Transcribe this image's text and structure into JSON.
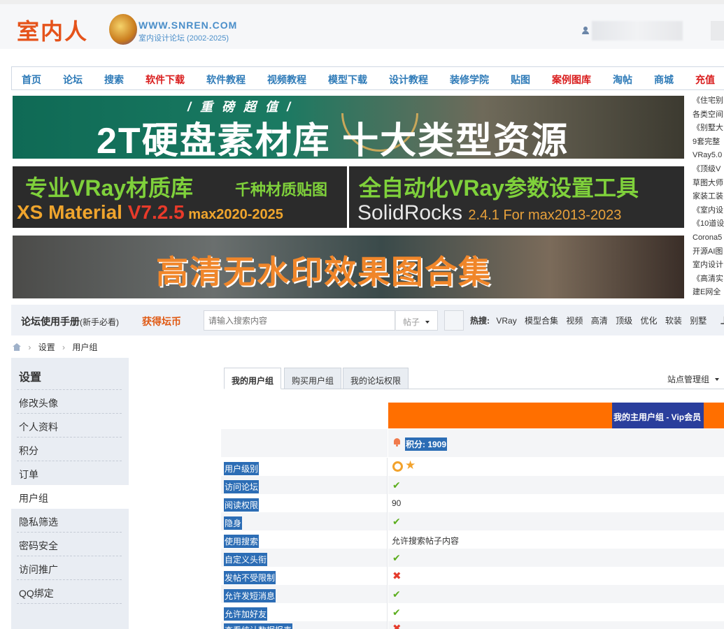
{
  "header": {
    "logo_text": "室内人",
    "site_url": "WWW.SNREN.COM",
    "site_sub": "室内设计论坛 (2002-2025)"
  },
  "nav": [
    {
      "label": "首页",
      "highlight": false
    },
    {
      "label": "论坛",
      "highlight": false
    },
    {
      "label": "搜索",
      "highlight": false
    },
    {
      "label": "软件下载",
      "highlight": true
    },
    {
      "label": "软件教程",
      "highlight": false
    },
    {
      "label": "视频教程",
      "highlight": false
    },
    {
      "label": "模型下载",
      "highlight": false
    },
    {
      "label": "设计教程",
      "highlight": false
    },
    {
      "label": "装修学院",
      "highlight": false
    },
    {
      "label": "贴图",
      "highlight": false
    },
    {
      "label": "案例图库",
      "highlight": true
    },
    {
      "label": "淘帖",
      "highlight": false
    },
    {
      "label": "商城",
      "highlight": false
    },
    {
      "label": "充值",
      "highlight": true
    }
  ],
  "banners": {
    "b1_sub": "/ 重 磅 超 值 /",
    "b1_main": "2T硬盘素材库  十大类型资源",
    "b2_l1": "专业VRay材质库",
    "b2_l1b": "千种材质贴图",
    "b2_l2a": "XS Material ",
    "b2_l2b": "V7.2.5",
    "b2_l2c": " max2020-2025",
    "b3_l1": "全自动化VRay参数设置工具",
    "b3_l2a": "SolidRocks ",
    "b3_l2b": "2.4.1 For max2013-2023",
    "b4_main": "高清无水印效果图合集"
  },
  "side_links": [
    "《住宅别",
    "各类空间",
    "《别墅大",
    "9套完整",
    "VRay5.0",
    "《顶级V",
    "草图大师",
    "家装工装",
    "《室内设",
    "《10道设",
    "Corona5",
    "开源AI图",
    "室内设计",
    "《高清实",
    "建E网全"
  ],
  "toolbar": {
    "manual": "论坛使用手册",
    "manual_note": "(新手必看)",
    "coins": "获得坛币",
    "search_placeholder": "请输入搜索内容",
    "search_type": "帖子",
    "hot_label": "热搜:",
    "hot_keywords": [
      "VRay",
      "模型合集",
      "视频",
      "高清",
      "顶级",
      "优化",
      "软装",
      "别墅"
    ],
    "right_char": "上"
  },
  "breadcrumb": [
    "设置",
    "用户组"
  ],
  "sidebar": {
    "title": "设置",
    "items": [
      "修改头像",
      "个人资料",
      "积分",
      "订单",
      "用户组",
      "隐私筛选",
      "密码安全",
      "访问推广",
      "QQ绑定"
    ],
    "active_index": 4
  },
  "tabs": [
    "我的用户组",
    "购买用户组",
    "我的论坛权限"
  ],
  "admin_menu": "站点管理组",
  "group_label": "我的主用户组 - Vip会员",
  "points_label": "积分: 1909",
  "permissions": [
    {
      "label": "用户级别",
      "type": "level"
    },
    {
      "label": "访问论坛",
      "type": "check"
    },
    {
      "label": "阅读权限",
      "type": "text",
      "value": "90"
    },
    {
      "label": "隐身",
      "type": "check"
    },
    {
      "label": "使用搜索",
      "type": "text",
      "value": "允许搜索帖子内容"
    },
    {
      "label": "自定义头衔",
      "type": "check"
    },
    {
      "label": "发帖不受限制",
      "type": "cross"
    },
    {
      "label": "允许发短消息",
      "type": "check"
    },
    {
      "label": "允许加好友",
      "type": "check"
    },
    {
      "label": "查看统计数据报表",
      "type": "cross"
    }
  ],
  "colors": {
    "accent_orange": "#ff6f00",
    "selection_blue": "#2c6db5",
    "nav_blue": "#2f7bb8",
    "nav_red": "#d91c1c"
  }
}
